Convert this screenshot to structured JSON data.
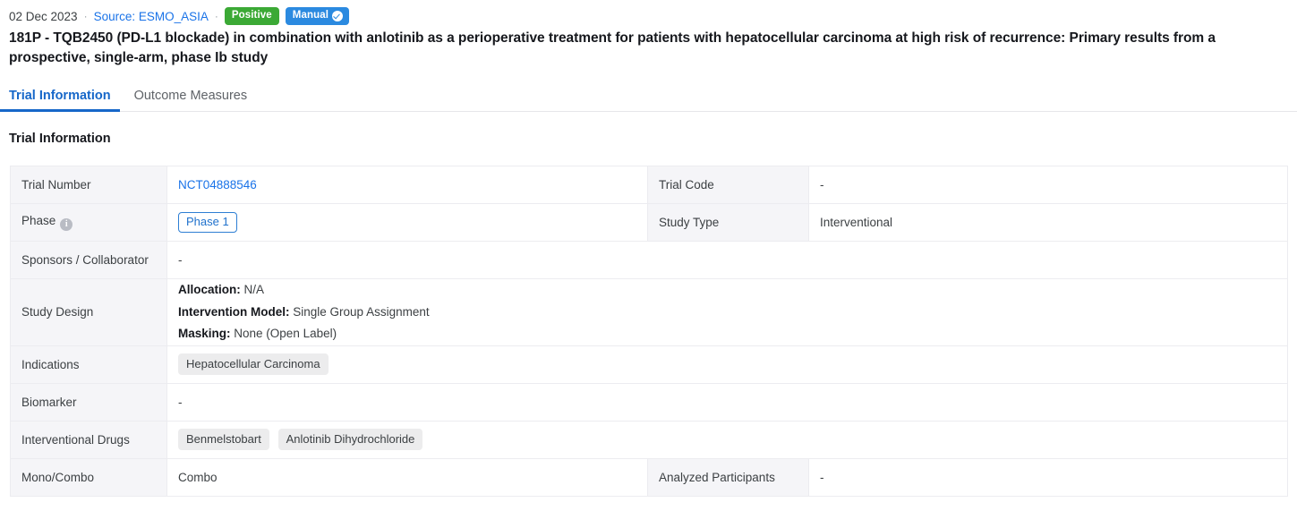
{
  "meta": {
    "date": "02 Dec 2023",
    "separator": "·",
    "source": "Source: ESMO_ASIA",
    "badges": [
      {
        "label": "Positive",
        "color": "#3ba935",
        "icon": null
      },
      {
        "label": "Manual",
        "color": "#2b8ae0",
        "icon": "check-circle-icon"
      }
    ]
  },
  "title": "181P - TQB2450 (PD-L1 blockade) in combination with anlotinib as a perioperative treatment for patients with hepatocellular carcinoma at high risk of recurrence: Primary results from a prospective, single-arm, phase Ib study",
  "tabs": [
    {
      "label": "Trial Information",
      "active": true
    },
    {
      "label": "Outcome Measures",
      "active": false
    }
  ],
  "section": {
    "heading": "Trial Information"
  },
  "table": {
    "rows": [
      {
        "label1": "Trial Number",
        "value1": "NCT04888546",
        "value1_type": "link",
        "label2": "Trial Code",
        "value2": "-"
      },
      {
        "label1": "Phase",
        "label1_icon": "info-icon",
        "value1": "Phase 1",
        "value1_type": "chip-outline",
        "label2": "Study Type",
        "value2": "Interventional"
      },
      {
        "label1": "Sponsors / Collaborator",
        "value1": "-",
        "value1_type": "text",
        "span": true
      },
      {
        "label1": "Study Design",
        "value1_type": "design",
        "span": true,
        "design": [
          {
            "key": "Allocation:",
            "val": "N/A"
          },
          {
            "key": "Intervention Model:",
            "val": "Single Group Assignment"
          },
          {
            "key": "Masking:",
            "val": "None (Open Label)"
          }
        ]
      },
      {
        "label1": "Indications",
        "value1_type": "chips",
        "span": true,
        "chips": [
          "Hepatocellular Carcinoma"
        ]
      },
      {
        "label1": "Biomarker",
        "value1": "-",
        "value1_type": "text",
        "span": true
      },
      {
        "label1": "Interventional Drugs",
        "value1_type": "chips",
        "span": true,
        "chips": [
          "Benmelstobart",
          "Anlotinib Dihydrochloride"
        ]
      },
      {
        "label1": "Mono/Combo",
        "value1": "Combo",
        "value1_type": "text",
        "label2": "Analyzed Participants",
        "value2": "-"
      }
    ]
  },
  "colors": {
    "accent": "#1667c9",
    "link": "#1a73e8",
    "positive": "#3ba935",
    "manual": "#2b8ae0",
    "label_bg": "#f5f5f8",
    "chip_bg": "#ececed"
  }
}
